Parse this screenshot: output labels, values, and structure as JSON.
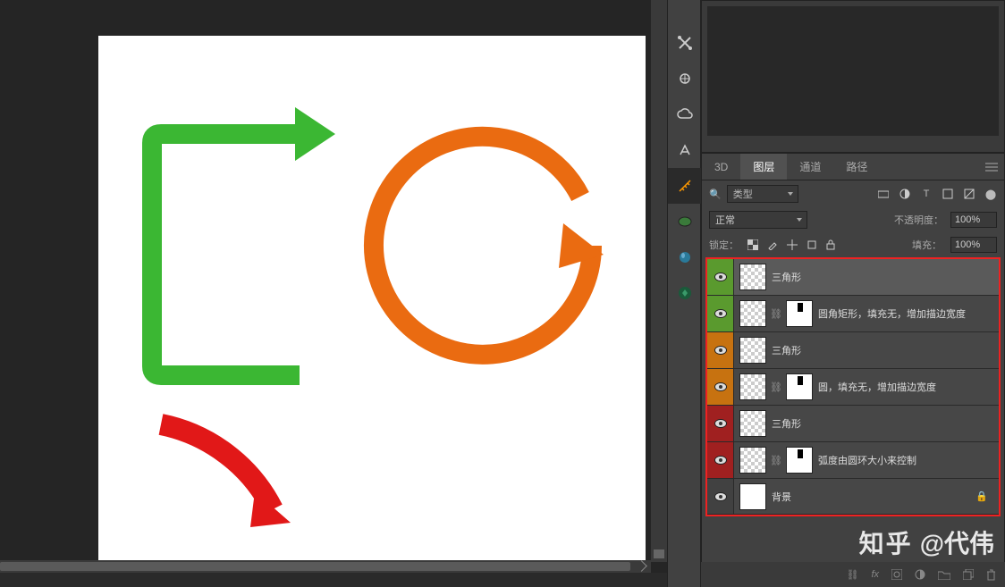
{
  "panel": {
    "tabs": {
      "t3d": "3D",
      "layers": "图层",
      "channels": "通道",
      "paths": "路径"
    },
    "filter_label": "类型",
    "blend_mode": "正常",
    "opacity_label": "不透明度：",
    "opacity_value": "100%",
    "lock_label": "锁定：",
    "fill_label": "填充：",
    "fill_value": "100%"
  },
  "layers": [
    {
      "name": "三角形",
      "color": "green"
    },
    {
      "name": "圆角矩形，填充无，增加描边宽度",
      "color": "green",
      "masked": true
    },
    {
      "name": "三角形",
      "color": "orange"
    },
    {
      "name": "圆，填充无，增加描边宽度",
      "color": "orange",
      "masked": true
    },
    {
      "name": "三角形",
      "color": "red"
    },
    {
      "name": "弧度由圆环大小来控制",
      "color": "red",
      "masked": true
    },
    {
      "name": "背景",
      "color": "gray",
      "locked": true
    }
  ],
  "watermark": {
    "site": "知乎",
    "author": "@代伟"
  },
  "colors": {
    "green": "#3bb733",
    "orange": "#ea6b11",
    "red": "#e11818"
  }
}
